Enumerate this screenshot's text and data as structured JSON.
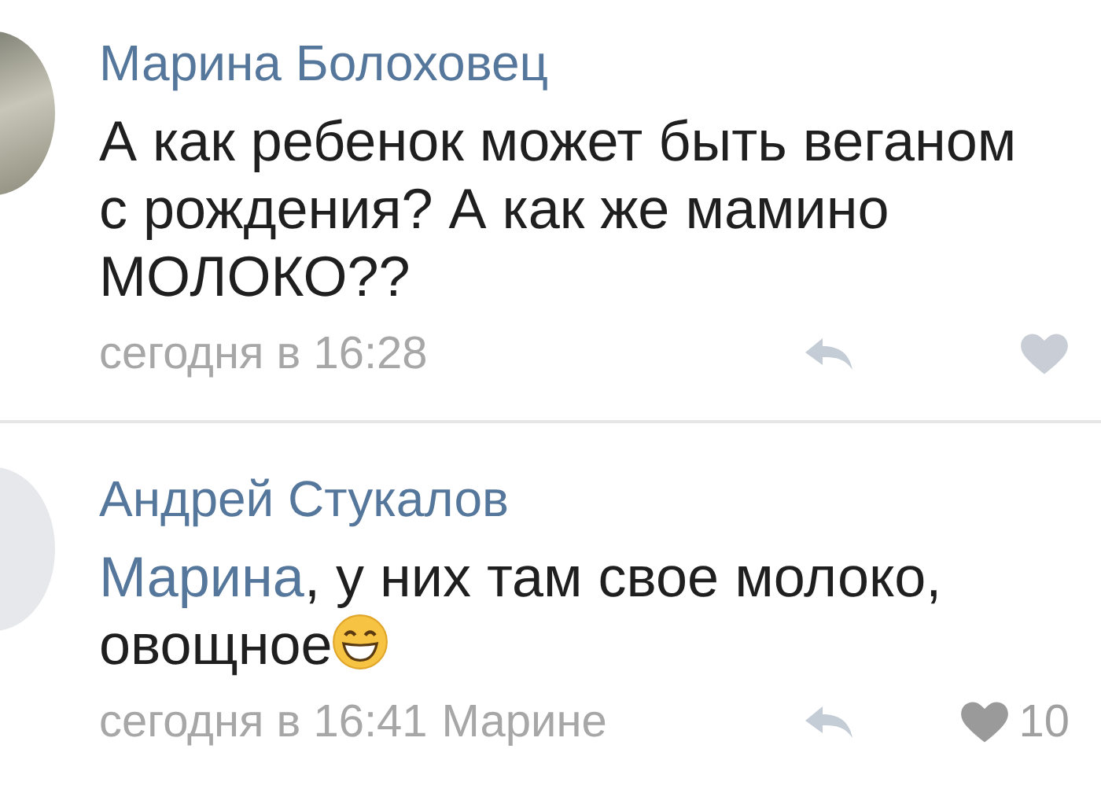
{
  "comments": [
    {
      "author": "Марина Болоховец",
      "avatar": {
        "kind": "photo"
      },
      "text": "А как ребенок может быть веганом с рождения? А как же мамино МОЛОКО??",
      "emoji": false,
      "time": "сегодня в 16:28"
    },
    {
      "author": "Андрей Стукалов",
      "avatar": {
        "kind": "blank"
      },
      "mention": "Марина",
      "text": ", у них там свое молоко, овощное",
      "emoji": true,
      "time": "сегодня в 16:41",
      "reply_to": "Марине",
      "likes": "10"
    }
  ]
}
